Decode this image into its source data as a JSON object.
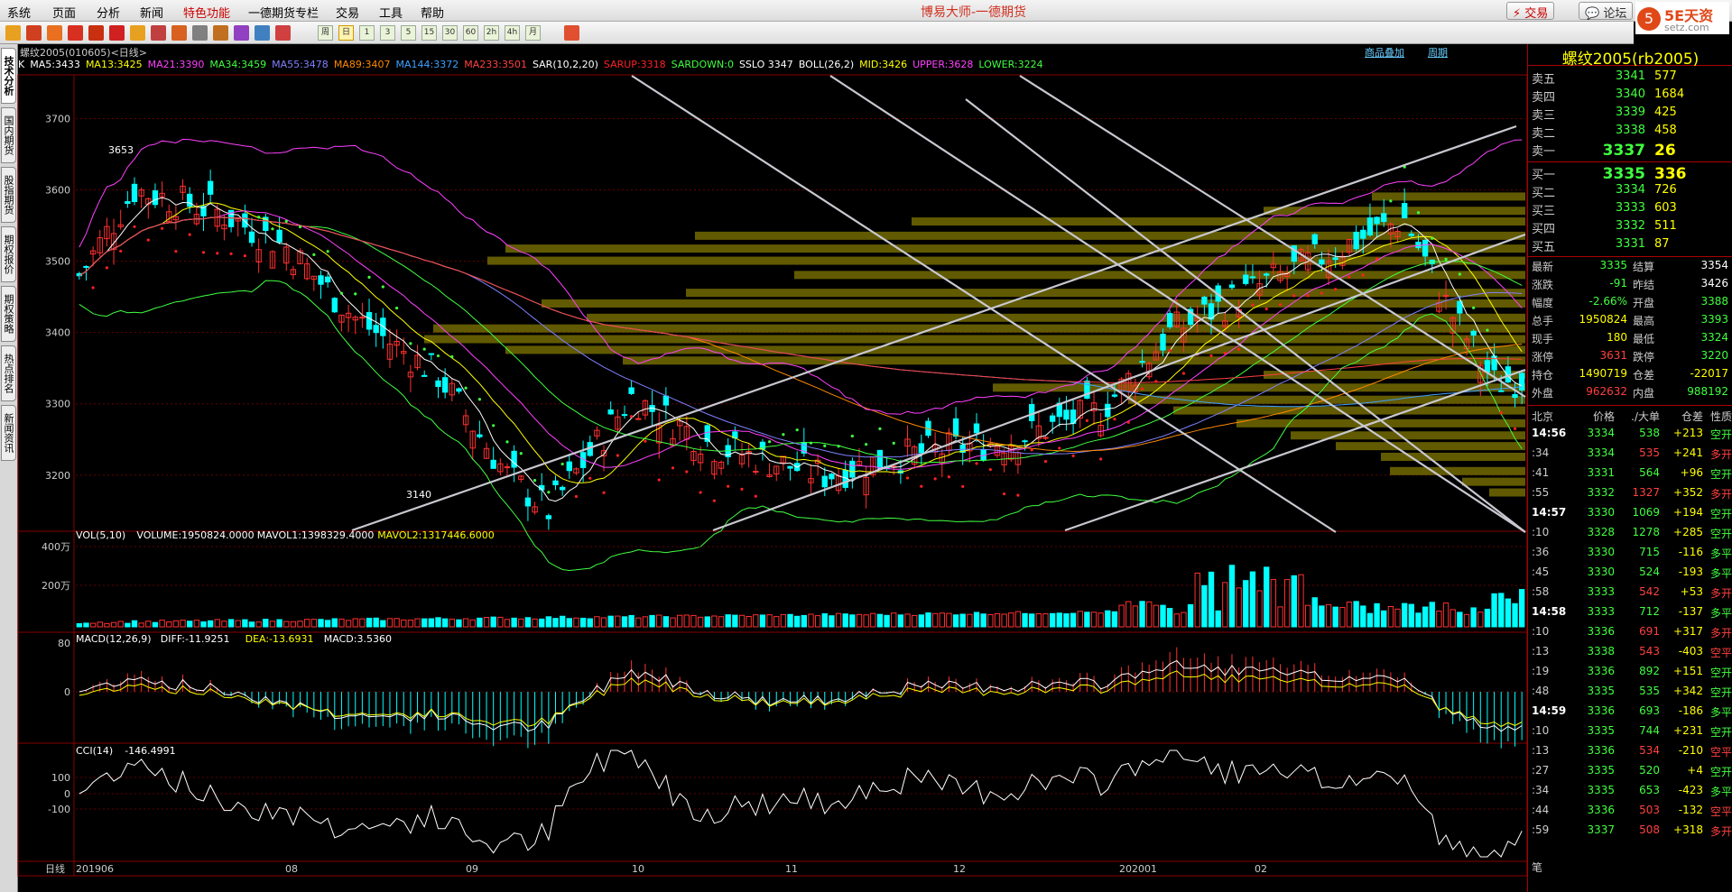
{
  "menu": [
    "系统",
    "页面",
    "分析",
    "新闻",
    "特色功能",
    "一德期货专栏",
    "交易",
    "工具",
    "帮助"
  ],
  "app_title": "博易大师-一德期货",
  "trade_btn": "交易",
  "forum_btn": "论坛",
  "logo": {
    "mark": "5",
    "name": "5E天资",
    "url": "setz.com"
  },
  "toolbar_buttons": [
    "周",
    "日",
    "1",
    "3",
    "5",
    "15",
    "30",
    "60",
    "2h",
    "4h",
    "月"
  ],
  "left_tabs": [
    "技术分析",
    "国内期货",
    "股指期货",
    "期权报价",
    "期权策略",
    "热点排名",
    "新闻资讯"
  ],
  "chart": {
    "symbol": "螺纹2005(010605)<日线>",
    "links": [
      "商品叠加",
      "周期"
    ],
    "indicators": [
      {
        "t": "K",
        "c": "#ffffff"
      },
      {
        "t": "MA5:3433",
        "c": "#ffffff"
      },
      {
        "t": "MA13:3425",
        "c": "#ffff00"
      },
      {
        "t": "MA21:3390",
        "c": "#ff40ff"
      },
      {
        "t": "MA34:3459",
        "c": "#40ff40"
      },
      {
        "t": "MA55:3478",
        "c": "#8080ff"
      },
      {
        "t": "MA89:3407",
        "c": "#ff8800"
      },
      {
        "t": "MA144:3372",
        "c": "#40a0ff"
      },
      {
        "t": "MA233:3501",
        "c": "#ff4040"
      },
      {
        "t": "SAR(10,2,20)",
        "c": "#ffffff"
      },
      {
        "t": "SARUP:3318",
        "c": "#ff2020"
      },
      {
        "t": "SARDOWN:0",
        "c": "#40ff40"
      },
      {
        "t": "SSLO 3347",
        "c": "#ffffff"
      },
      {
        "t": "BOLL(26,2)",
        "c": "#ffffff"
      },
      {
        "t": "MID:3426",
        "c": "#ffff00"
      },
      {
        "t": "UPPER:3628",
        "c": "#ff40ff"
      },
      {
        "t": "LOWER:3224",
        "c": "#40ff40"
      }
    ],
    "price_ticks": [
      "3700",
      "3600",
      "3500",
      "3400",
      "3300",
      "3200"
    ],
    "high_label": "3653",
    "low_label": "3140",
    "vol_header": [
      {
        "t": "VOL(5,10)",
        "c": "#ffffff"
      },
      {
        "t": "VOLUME:1950824.0000",
        "c": "#ffffff"
      },
      {
        "t": "MAVOL1:1398329.4000",
        "c": "#ffffff"
      },
      {
        "t": "MAVOL2:1317446.6000",
        "c": "#ffff00"
      }
    ],
    "vol_ticks": [
      "400万",
      "200万"
    ],
    "macd_header": [
      {
        "t": "MACD(12,26,9)",
        "c": "#ffffff"
      },
      {
        "t": "DIFF:-11.9251",
        "c": "#ffffff"
      },
      {
        "t": "DEA:-13.6931",
        "c": "#ffff00"
      },
      {
        "t": "MACD:3.5360",
        "c": "#ffffff"
      }
    ],
    "macd_ticks": [
      "80",
      "0"
    ],
    "cci_header": [
      {
        "t": "CCI(14)",
        "c": "#ffffff"
      },
      {
        "t": "-146.4991",
        "c": "#ffffff"
      }
    ],
    "cci_ticks": [
      "100",
      "0",
      "-100"
    ],
    "period_label": "日线",
    "x_labels": [
      "201906",
      "08",
      "09",
      "10",
      "11",
      "12",
      "202001",
      "02"
    ]
  },
  "quote": {
    "title": "螺纹2005(rb2005)",
    "asks": [
      {
        "l": "卖五",
        "p": "3341",
        "v": "577"
      },
      {
        "l": "卖四",
        "p": "3340",
        "v": "1684"
      },
      {
        "l": "卖三",
        "p": "3339",
        "v": "425"
      },
      {
        "l": "卖二",
        "p": "3338",
        "v": "458"
      },
      {
        "l": "卖一",
        "p": "3337",
        "v": "26"
      }
    ],
    "bids": [
      {
        "l": "买一",
        "p": "3335",
        "v": "336"
      },
      {
        "l": "买二",
        "p": "3334",
        "v": "726"
      },
      {
        "l": "买三",
        "p": "3333",
        "v": "603"
      },
      {
        "l": "买四",
        "p": "3332",
        "v": "511"
      },
      {
        "l": "买五",
        "p": "3331",
        "v": "87"
      }
    ],
    "stats": [
      {
        "l1": "最新",
        "v1": "3335",
        "c1": "g",
        "l2": "结算",
        "v2": "3354",
        "c2": "w"
      },
      {
        "l1": "涨跌",
        "v1": "-91",
        "c1": "g",
        "l2": "昨结",
        "v2": "3426",
        "c2": "w"
      },
      {
        "l1": "幅度",
        "v1": "-2.66%",
        "c1": "g",
        "l2": "开盘",
        "v2": "3388",
        "c2": "g"
      },
      {
        "l1": "总手",
        "v1": "1950824",
        "c1": "y",
        "l2": "最高",
        "v2": "3393",
        "c2": "g"
      },
      {
        "l1": "现手",
        "v1": "180",
        "c1": "y",
        "l2": "最低",
        "v2": "3324",
        "c2": "g"
      },
      {
        "l1": "涨停",
        "v1": "3631",
        "c1": "r",
        "l2": "跌停",
        "v2": "3220",
        "c2": "g"
      },
      {
        "l1": "持仓",
        "v1": "1490719",
        "c1": "y",
        "l2": "仓差",
        "v2": "-22017",
        "c2": "y"
      },
      {
        "l1": "外盘",
        "v1": "962632",
        "c1": "r",
        "l2": "内盘",
        "v2": "988192",
        "c2": "g"
      }
    ],
    "ticks_header": [
      "北京",
      "价格",
      "./大单",
      "仓差",
      "性质"
    ],
    "ticks": [
      {
        "t": "14:56",
        "p": "3334",
        "q": "538",
        "qc": "g",
        "d": "+213",
        "k": "空开",
        "kc": "g"
      },
      {
        "t": ":34",
        "p": "3334",
        "q": "535",
        "qc": "r",
        "d": "+241",
        "k": "多开",
        "kc": "r"
      },
      {
        "t": ":41",
        "p": "3331",
        "q": "564",
        "qc": "g",
        "d": "+96",
        "k": "空开",
        "kc": "g"
      },
      {
        "t": ":55",
        "p": "3332",
        "q": "1327",
        "qc": "r",
        "d": "+352",
        "k": "多开",
        "kc": "r"
      },
      {
        "t": "14:57",
        "p": "3330",
        "q": "1069",
        "qc": "g",
        "d": "+194",
        "k": "空开",
        "kc": "g"
      },
      {
        "t": ":10",
        "p": "3328",
        "q": "1278",
        "qc": "g",
        "d": "+285",
        "k": "空开",
        "kc": "g"
      },
      {
        "t": ":36",
        "p": "3330",
        "q": "715",
        "qc": "g",
        "d": "-116",
        "k": "多平",
        "kc": "g"
      },
      {
        "t": ":45",
        "p": "3330",
        "q": "524",
        "qc": "g",
        "d": "-193",
        "k": "多平",
        "kc": "g"
      },
      {
        "t": ":58",
        "p": "3333",
        "q": "542",
        "qc": "r",
        "d": "+53",
        "k": "多开",
        "kc": "r"
      },
      {
        "t": "14:58",
        "p": "3333",
        "q": "712",
        "qc": "g",
        "d": "-137",
        "k": "多平",
        "kc": "g"
      },
      {
        "t": ":10",
        "p": "3336",
        "q": "691",
        "qc": "r",
        "d": "+317",
        "k": "多开",
        "kc": "r"
      },
      {
        "t": ":13",
        "p": "3338",
        "q": "543",
        "qc": "r",
        "d": "-403",
        "k": "空平",
        "kc": "r"
      },
      {
        "t": ":19",
        "p": "3336",
        "q": "892",
        "qc": "g",
        "d": "+151",
        "k": "空开",
        "kc": "g"
      },
      {
        "t": ":48",
        "p": "3335",
        "q": "535",
        "qc": "g",
        "d": "+342",
        "k": "空开",
        "kc": "g"
      },
      {
        "t": "14:59",
        "p": "3336",
        "q": "693",
        "qc": "g",
        "d": "-186",
        "k": "多平",
        "kc": "g"
      },
      {
        "t": ":10",
        "p": "3335",
        "q": "744",
        "qc": "g",
        "d": "+231",
        "k": "空开",
        "kc": "g"
      },
      {
        "t": ":13",
        "p": "3336",
        "q": "534",
        "qc": "r",
        "d": "-210",
        "k": "空平",
        "kc": "r"
      },
      {
        "t": ":27",
        "p": "3335",
        "q": "520",
        "qc": "g",
        "d": "+4",
        "k": "空开",
        "kc": "g"
      },
      {
        "t": ":34",
        "p": "3335",
        "q": "653",
        "qc": "g",
        "d": "-423",
        "k": "多平",
        "kc": "g"
      },
      {
        "t": ":44",
        "p": "3336",
        "q": "503",
        "qc": "r",
        "d": "-132",
        "k": "空平",
        "kc": "r"
      },
      {
        "t": ":59",
        "p": "3337",
        "q": "508",
        "qc": "r",
        "d": "+318",
        "k": "多开",
        "kc": "r"
      }
    ],
    "footer_tab": "笔"
  }
}
